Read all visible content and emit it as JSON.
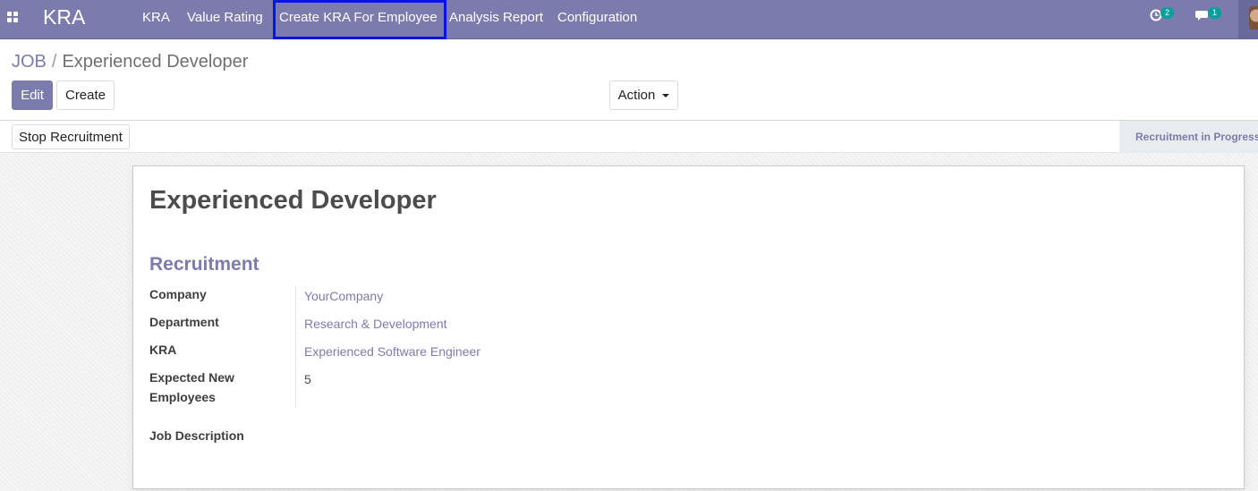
{
  "navbar": {
    "app_name": "KRA",
    "menu": [
      {
        "label": "KRA"
      },
      {
        "label": "Value Rating"
      },
      {
        "label": "Create KRA For Employee"
      },
      {
        "label": "Analysis Report"
      },
      {
        "label": "Configuration"
      }
    ],
    "activity_count": "2",
    "messages_count": "1",
    "highlight_color": "#0a14e0",
    "bar_color": "#7c7bad"
  },
  "breadcrumb": {
    "parent": "JOB",
    "separator": "/",
    "current": "Experienced Developer"
  },
  "buttons": {
    "edit": "Edit",
    "create": "Create",
    "action": "Action",
    "stop_recruitment": "Stop Recruitment"
  },
  "status": {
    "stage": "Recruitment in Progress"
  },
  "form": {
    "title": "Experienced Developer",
    "group_title": "Recruitment",
    "fields": [
      {
        "label": "Company",
        "value": "YourCompany"
      },
      {
        "label": "Department",
        "value": "Research & Development"
      },
      {
        "label": "KRA",
        "value": "Experienced Software Engineer"
      },
      {
        "label": "Expected New Employees",
        "value": "5"
      }
    ],
    "job_description_label": "Job Description"
  }
}
